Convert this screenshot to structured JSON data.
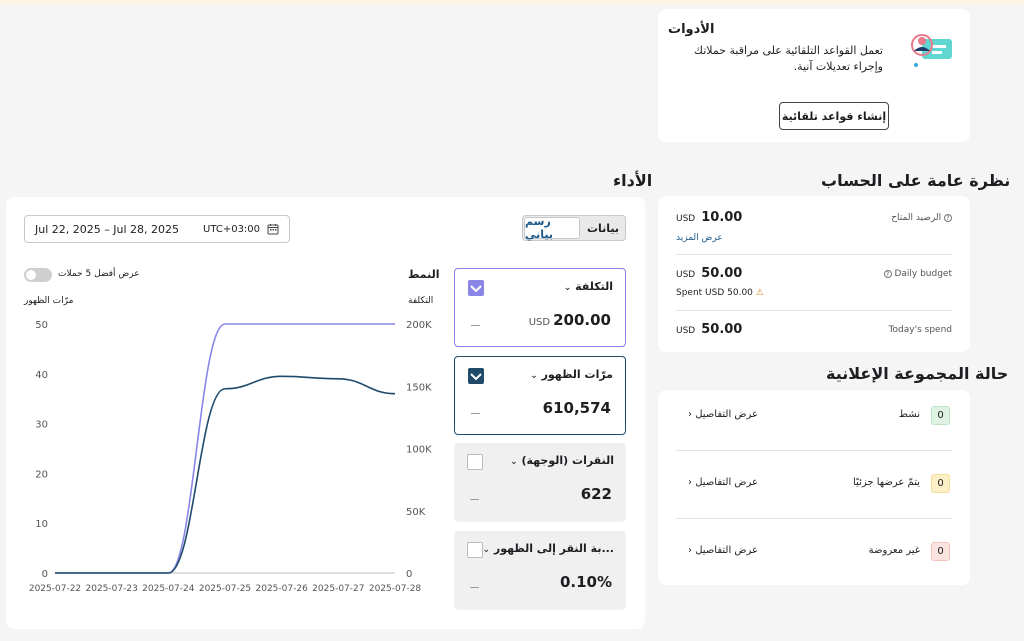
{
  "tools": {
    "title": "الأدوات",
    "description": "تعمل القواعد التلقائية على مراقبة حملاتك وإجراء تعديلات آنية.",
    "button": "إنشاء قواعد تلقائية"
  },
  "performance": {
    "heading": "الأداء",
    "date_range": "Jul 22, 2025 – Jul 28, 2025",
    "timezone": "UTC+03:00",
    "view_tabs": [
      "رسم بياني",
      "بيانات"
    ],
    "active_tab": "رسم بياني",
    "toggle_label": "عرض أفضل 5 حملات",
    "pattern_label": "النمط",
    "left_axis_label": "مرّات الظهور",
    "right_axis_label": "التكلفة",
    "metrics": [
      {
        "name": "التكلفة",
        "currency": "USD",
        "value": "200.00",
        "checked": true,
        "color": "#8a86e8"
      },
      {
        "name": "مرّات الظهور",
        "currency": "",
        "value": "610,574",
        "checked": true,
        "color": "#1f4a6a"
      },
      {
        "name": "النقرات (الوجهة)",
        "currency": "",
        "value": "622",
        "checked": false,
        "color": ""
      },
      {
        "name": "...بة النقر إلى الظهور",
        "currency": "",
        "value": "0.10%",
        "checked": false,
        "color": ""
      }
    ]
  },
  "chart_data": {
    "type": "line",
    "x": [
      "2025-07-22",
      "2025-07-23",
      "2025-07-24",
      "2025-07-25",
      "2025-07-26",
      "2025-07-27",
      "2025-07-28"
    ],
    "y_left": {
      "label": "مرّات الظهور",
      "ticks": [
        "0",
        "10",
        "20",
        "30",
        "40",
        "50"
      ],
      "ylim": [
        0,
        50
      ]
    },
    "y_right": {
      "label": "التكلفة",
      "ticks": [
        "0",
        "50K",
        "100K",
        "150K",
        "200K"
      ],
      "ylim": [
        0,
        200000
      ]
    },
    "series": [
      {
        "name": "التكلفة",
        "axis": "left",
        "color": "#8a86e8",
        "values": [
          0,
          0,
          0,
          50,
          50,
          50,
          50
        ]
      },
      {
        "name": "مرّات الظهور",
        "axis": "left",
        "color": "#1f4a6a",
        "values": [
          0,
          0,
          0,
          37,
          39.5,
          39,
          36
        ]
      }
    ],
    "grid": false,
    "legend": "none"
  },
  "overview": {
    "heading": "نظرة عامة على الحساب",
    "rows": [
      {
        "label": "الرصيد المتاح",
        "currency": "USD",
        "value": "10.00",
        "extra": "عرض المزيد"
      },
      {
        "label": "Daily budget",
        "currency": "USD",
        "value": "50.00",
        "extra": "Spent USD 50.00"
      },
      {
        "label": "Today's spend",
        "currency": "USD",
        "value": "50.00",
        "extra": ""
      }
    ]
  },
  "adset": {
    "heading": "حالة المجموعة الإعلانية",
    "rows": [
      {
        "label": "نشط",
        "count": "0",
        "link": "عرض التفاصيل"
      },
      {
        "label": "يتمّ عرضها جزئيًا",
        "count": "0",
        "link": "عرض التفاصيل"
      },
      {
        "label": "غير معروضة",
        "count": "0",
        "link": "عرض التفاصيل"
      }
    ]
  }
}
